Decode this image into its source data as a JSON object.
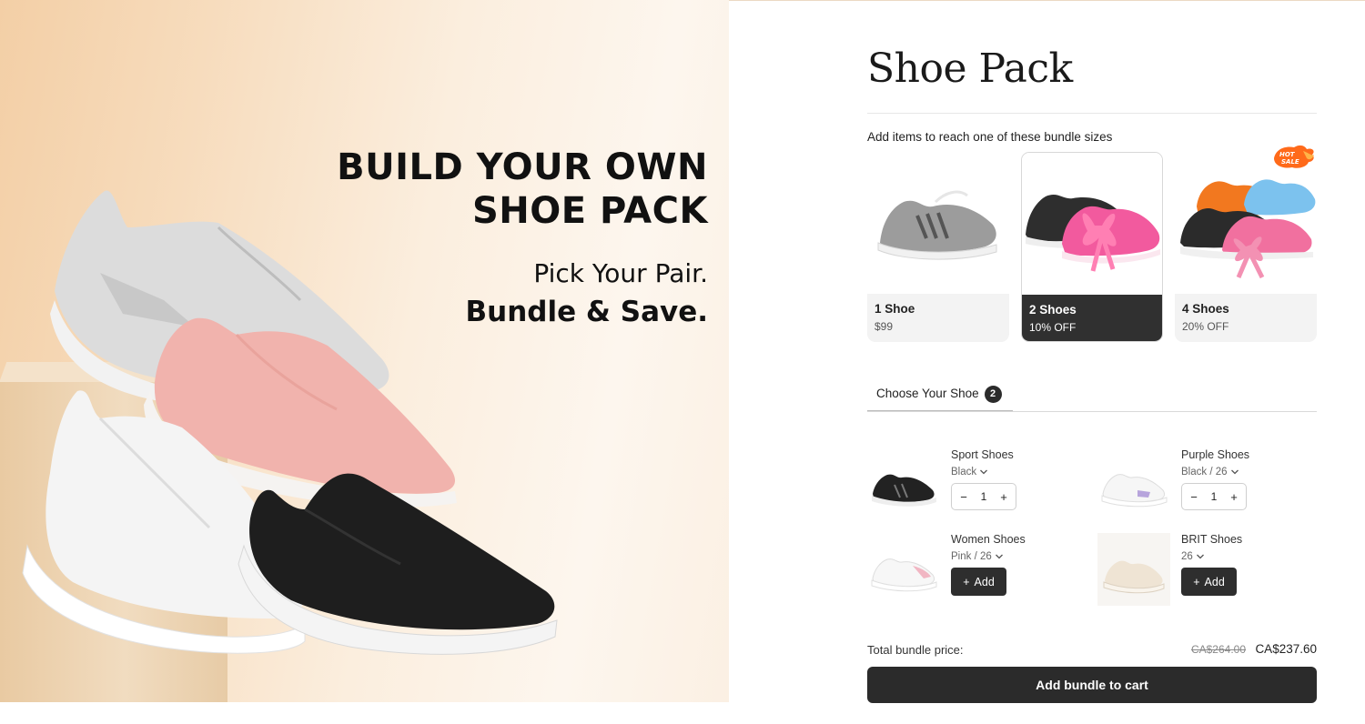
{
  "hero": {
    "headline": "BUILD YOUR OWN\nSHOE PACK",
    "tagline_1": "Pick Your Pair.",
    "tagline_2": "Bundle & Save."
  },
  "bundle": {
    "title": "Shoe Pack",
    "hint": "Add items to reach one of these bundle sizes",
    "tiers": [
      {
        "label": "1 Shoe",
        "sub": "$99",
        "selected": false
      },
      {
        "label": "2 Shoes",
        "sub": "10% OFF",
        "selected": true
      },
      {
        "label": "4 Shoes",
        "sub": "20% OFF",
        "selected": false
      }
    ],
    "hot_badge": "HOT SALE"
  },
  "chooser": {
    "tab_label": "Choose Your Shoe",
    "tab_count": "2",
    "products": [
      {
        "name": "Sport Shoes",
        "variant": "Black",
        "quantity": "1",
        "in_bundle": true,
        "shoe_color": "black"
      },
      {
        "name": "Purple Shoes",
        "variant": "Black / 26",
        "quantity": "1",
        "in_bundle": true,
        "shoe_color": "white-purple"
      },
      {
        "name": "Women Shoes",
        "variant": "Pink / 26",
        "in_bundle": false,
        "add_label": "Add",
        "shoe_color": "white-pink"
      },
      {
        "name": "BRIT Shoes",
        "variant": "26",
        "in_bundle": false,
        "add_label": "Add",
        "shoe_color": "cream"
      }
    ]
  },
  "summary": {
    "total_label": "Total bundle price:",
    "original_price": "CA$264.00",
    "bundle_price": "CA$237.60",
    "cta_label": "Add bundle to cart"
  },
  "icons": {
    "variant_dropdown": "chevron-down-icon",
    "minus": "minus-icon",
    "plus": "plus-icon"
  },
  "colors": {
    "dark": "#2b2b2b",
    "hero_peach": "#f3cfa6",
    "badge_orange": "#ff6a1a"
  }
}
